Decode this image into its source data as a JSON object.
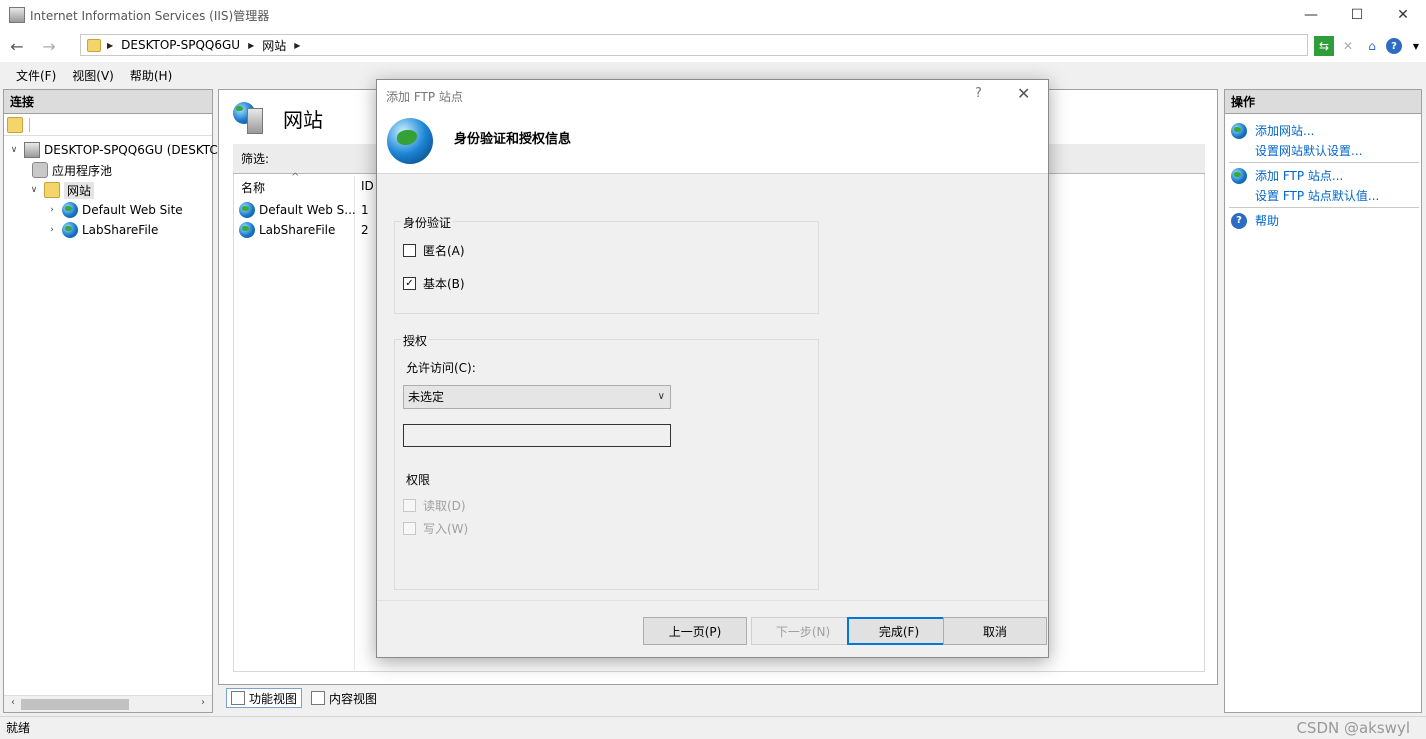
{
  "window": {
    "title": "Internet Information Services (IIS)管理器",
    "minimize": "—",
    "maximize": "☐",
    "close": "✕"
  },
  "address": {
    "back": "←",
    "forward": "→",
    "segments": [
      "DESKTOP-SPQQ6GU",
      "网站"
    ],
    "separator": "▶"
  },
  "menu": [
    "文件(F)",
    "视图(V)",
    "帮助(H)"
  ],
  "connections": {
    "header": "连接",
    "tree": [
      {
        "label": "DESKTOP-SPQQ6GU (DESKTC",
        "icon": "server-icon"
      },
      {
        "label": "应用程序池",
        "icon": "app-pool-icon"
      },
      {
        "label": "网站",
        "icon": "sites-folder-icon"
      },
      {
        "label": "Default Web Site",
        "icon": "globe-icon"
      },
      {
        "label": "LabShareFile",
        "icon": "globe-icon"
      }
    ]
  },
  "center": {
    "title": "网站",
    "filter_label": "筛选:",
    "columns": [
      "名称",
      "ID"
    ],
    "rows": [
      {
        "name": "Default Web S...",
        "id": "1"
      },
      {
        "name": "LabShareFile",
        "id": "2"
      }
    ],
    "tabs": [
      "功能视图",
      "内容视图"
    ]
  },
  "actions": {
    "header": "操作",
    "items": [
      "添加网站...",
      "设置网站默认设置...",
      "添加 FTP 站点...",
      "设置 FTP 站点默认值...",
      "帮助"
    ]
  },
  "status": {
    "text": "就绪",
    "watermark": "CSDN @akswyl"
  },
  "dialog": {
    "title": "添加 FTP 站点",
    "help": "?",
    "close": "✕",
    "heading": "身份验证和授权信息",
    "auth_group": "身份验证",
    "anonymous": {
      "label": "匿名(A)",
      "checked": false
    },
    "basic": {
      "label": "基本(B)",
      "checked": true,
      "mark": "✓"
    },
    "authz_group": "授权",
    "allow_label": "允许访问(C):",
    "allow_value": "未选定",
    "textbox_value": "",
    "perm_group": "权限",
    "read": {
      "label": "读取(D)",
      "checked": false
    },
    "write": {
      "label": "写入(W)",
      "checked": false
    },
    "buttons": {
      "prev": "上一页(P)",
      "next": "下一步(N)",
      "finish": "完成(F)",
      "cancel": "取消"
    }
  }
}
